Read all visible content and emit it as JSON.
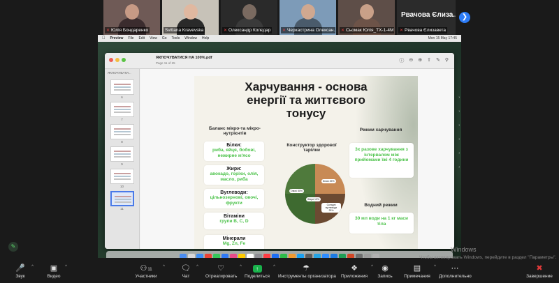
{
  "participants": [
    {
      "name": "Юлія Бондаренко",
      "muted": true,
      "bg": "#6f5a56",
      "face": "#c79a85",
      "body": "#3b2c2e"
    },
    {
      "name": "Svitlana Kravevska",
      "muted": false,
      "active": true,
      "bg": "#c7c2b8",
      "face": "#e0b8a0",
      "body": "#2a2a2a"
    },
    {
      "name": "Олександр Колєдар",
      "muted": true,
      "bg": "#2a2a2a",
      "face": "#7a6a60",
      "body": "#3a3a3a"
    },
    {
      "name": "Черкастрина Олексан...",
      "muted": true,
      "bg": "#7d9bb8",
      "face": "#d0a890",
      "body": "#4a5b6b"
    },
    {
      "name": "Сьомак Юлія_ТХ-1-4М",
      "muted": true,
      "bg": "#5e4e48",
      "face": "#c9a088",
      "body": "#6d5348"
    },
    {
      "name": "Рвачова Єлизавета",
      "muted": true,
      "display_name": "Рвачова Єлиза...",
      "no_video": true
    }
  ],
  "mac_menu": {
    "app": "Preview",
    "items": [
      "File",
      "Edit",
      "View",
      "Go",
      "Tools",
      "Window",
      "Help"
    ],
    "clock": "Mon 15 May  17:45"
  },
  "preview": {
    "doc_title": "ЯКПОЧУВАТИСЯ НА 100%.pdf",
    "page_info": "Page 11 of 25",
    "sidebar_label": "ЯКПОЧУВАТИ...",
    "page_numbers": [
      "6",
      "7",
      "8",
      "9",
      "10",
      "11"
    ]
  },
  "slide": {
    "title_line1": "Харчування - основа",
    "title_line2": "енергії та життєвого",
    "title_line3": "тонусу",
    "balance_header": "Баланс мікро-та мікро-нутрієнтів",
    "plate_header": "Конструктор здорової тарілки",
    "regime_header": "Режим харчування",
    "water_header": "Водний режим",
    "cards": {
      "proteins_title": "Білки:",
      "proteins_text": "риба, яйця, бобові, нежирне м'ясо",
      "fats_title": "Жири:",
      "fats_text": "авокадо, горіхи, олія, масло, риба",
      "carbs_title": "Вуглеводи:",
      "carbs_text": "цільнозернові, овочі, фрукти",
      "vitamins_title": "Вітаміни",
      "vitamins_text": "групи B, C, D",
      "minerals_title": "Мінерали",
      "minerals_text": "Mg, Zn, Fe",
      "regime_text": "3х разове харчування з інтервалом між прийомами їжі 4 години",
      "water_text": "30 мл води на 1 кг маси тіла"
    },
    "plate_labels": {
      "veg": "Овочі 50%",
      "protein": "Білки 25%",
      "fat": "Жири 10%",
      "carb": "Складні вуглеводи 25%"
    }
  },
  "windows_watermark": {
    "line1": "Windows",
    "line2": "Чтобы активировать Windows, перейдите в раздел \"Параметры\"."
  },
  "toolbar": {
    "mute": "Звук",
    "video": "Видео",
    "participants": "Участники",
    "participants_count": "11",
    "chat": "Чат",
    "react": "Отреагировать",
    "share": "Поделиться",
    "host_tools": "Инструменты организатора",
    "apps": "Приложения",
    "record": "Запись",
    "annotate": "Примечания",
    "more": "Дополнительно",
    "end": "Завершение"
  }
}
